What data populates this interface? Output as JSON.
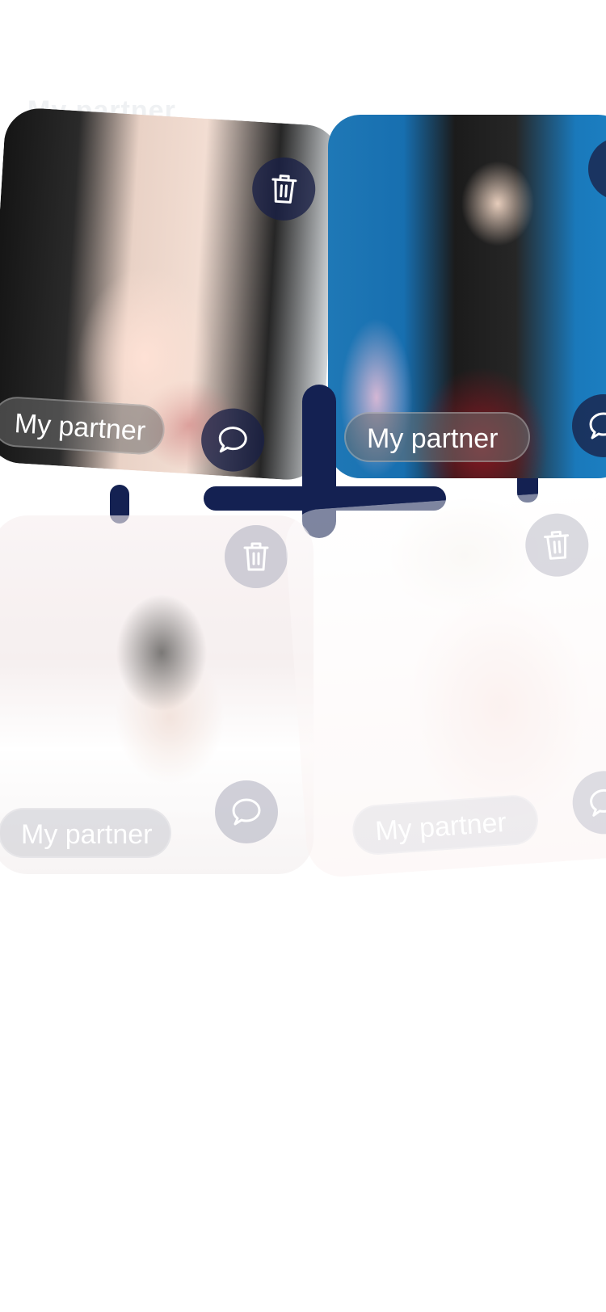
{
  "page": {
    "header_title": "My partner"
  },
  "cards": [
    {
      "label": "My partner",
      "delete_icon": "trash-icon",
      "chat_icon": "chat-bubble-icon"
    },
    {
      "label": "My partner",
      "delete_icon": "trash-icon",
      "chat_icon": "chat-bubble-icon"
    },
    {
      "label": "My partner",
      "delete_icon": "trash-icon",
      "chat_icon": "chat-bubble-icon"
    },
    {
      "label": "My partner",
      "delete_icon": "trash-icon",
      "chat_icon": "chat-bubble-icon"
    }
  ],
  "add_button": {
    "icon": "plus-icon"
  },
  "colors": {
    "accent": "#142152",
    "pill_bg": "#6e6e6e",
    "text_on_dark": "#ffffff",
    "background": "#ffffff"
  }
}
